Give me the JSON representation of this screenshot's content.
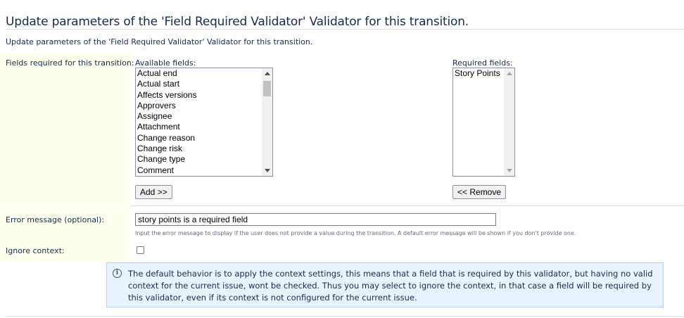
{
  "header": {
    "title": "Update parameters of the 'Field Required Validator' Validator for this transition.",
    "subtitle": "Update parameters of the 'Field Required Validator' Validator for this transition."
  },
  "fields_section": {
    "label": "Fields required for this transition:",
    "available_label": "Available fields:",
    "required_label": "Required fields:",
    "available_fields": [
      "Actual end",
      "Actual start",
      "Affects versions",
      "Approvers",
      "Assignee",
      "Attachment",
      "Change reason",
      "Change risk",
      "Change type",
      "Comment"
    ],
    "required_fields": [
      "Story Points"
    ],
    "add_button": "Add >>",
    "remove_button": "<< Remove"
  },
  "error_message": {
    "label": "Error message (optional):",
    "value": "story points is a required field",
    "help": "Input the error message to display if the user does not provide a value during the transition. A default error message will be shown if you don't provide one."
  },
  "ignore_context": {
    "label": "Ignore context:",
    "checked": false
  },
  "info": {
    "icon": "info-icon",
    "glyph": "i",
    "text": "The default behavior is to apply the context settings, this means that a field that is required by this validator, but having no valid context for the current issue, wont be checked. Thus you may select to ignore the context, in that case a field will be required by this validator, even if its context is not configured for the current issue."
  }
}
